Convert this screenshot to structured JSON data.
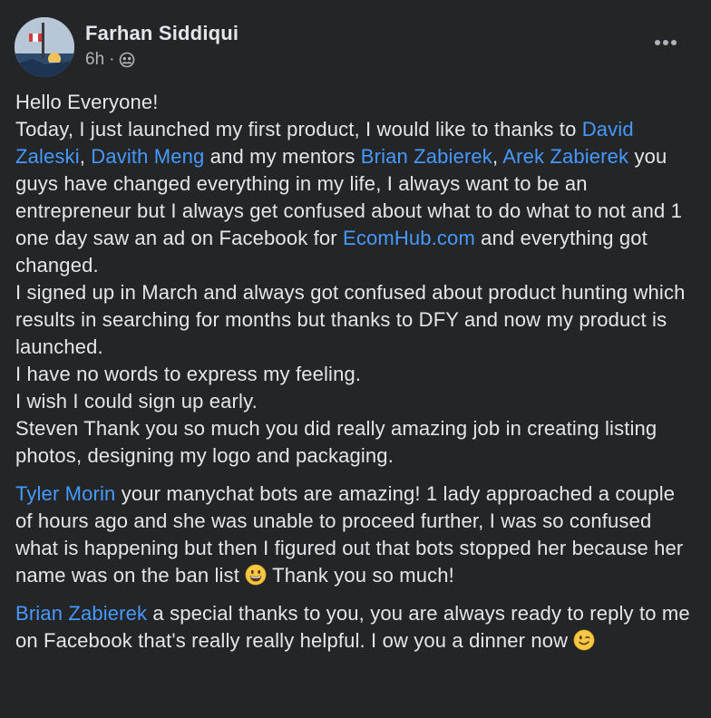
{
  "post": {
    "author": "Farhan Siddiqui",
    "time": "6h",
    "separator": "·",
    "privacy_icon": "friends-icon",
    "more_icon": "more-options-icon"
  },
  "paragraphs": [
    [
      {
        "type": "text",
        "text": "Hello Everyone!\nToday, I just launched my first product, I would like to thanks to "
      },
      {
        "type": "mention",
        "text": "David Zaleski"
      },
      {
        "type": "text",
        "text": ", "
      },
      {
        "type": "mention",
        "text": "Davith Meng"
      },
      {
        "type": "text",
        "text": " and my mentors "
      },
      {
        "type": "mention",
        "text": "Brian Zabierek"
      },
      {
        "type": "text",
        "text": ", "
      },
      {
        "type": "mention",
        "text": "Arek Zabierek"
      },
      {
        "type": "text",
        "text": " you guys have changed everything in my life, I always want to be an entrepreneur but I always get confused about what to do what to not and 1 one day saw an ad on Facebook for "
      },
      {
        "type": "link",
        "text": "EcomHub.com"
      },
      {
        "type": "text",
        "text": " and everything got changed.\nI signed up in March and always got confused about product hunting which results in searching for months but thanks to DFY and now my product is launched.\nI have no words to express my feeling.\nI wish I could sign up early.\nSteven Thank you so much you did really amazing job in creating listing photos, designing my logo and packaging."
      }
    ],
    [
      {
        "type": "mention",
        "text": "Tyler Morin"
      },
      {
        "type": "text",
        "text": " your manychat bots are amazing! 1 lady approached a couple of hours ago and she was unable to proceed further, I was so confused what is happening but then I figured out that bots stopped her because her name was on the ban list "
      },
      {
        "type": "emoji",
        "name": "grinning-face-emoji"
      },
      {
        "type": "text",
        "text": " Thank you so much!"
      }
    ],
    [
      {
        "type": "mention",
        "text": "Brian Zabierek"
      },
      {
        "type": "text",
        "text": " a special thanks to you, you are always ready to reply to me on Facebook that's really really helpful. I ow you a dinner now "
      },
      {
        "type": "emoji",
        "name": "winking-face-emoji"
      }
    ]
  ],
  "colors": {
    "background": "#242526",
    "text": "#e4e6eb",
    "secondary_text": "#b0b3b8",
    "link": "#4599ff"
  }
}
